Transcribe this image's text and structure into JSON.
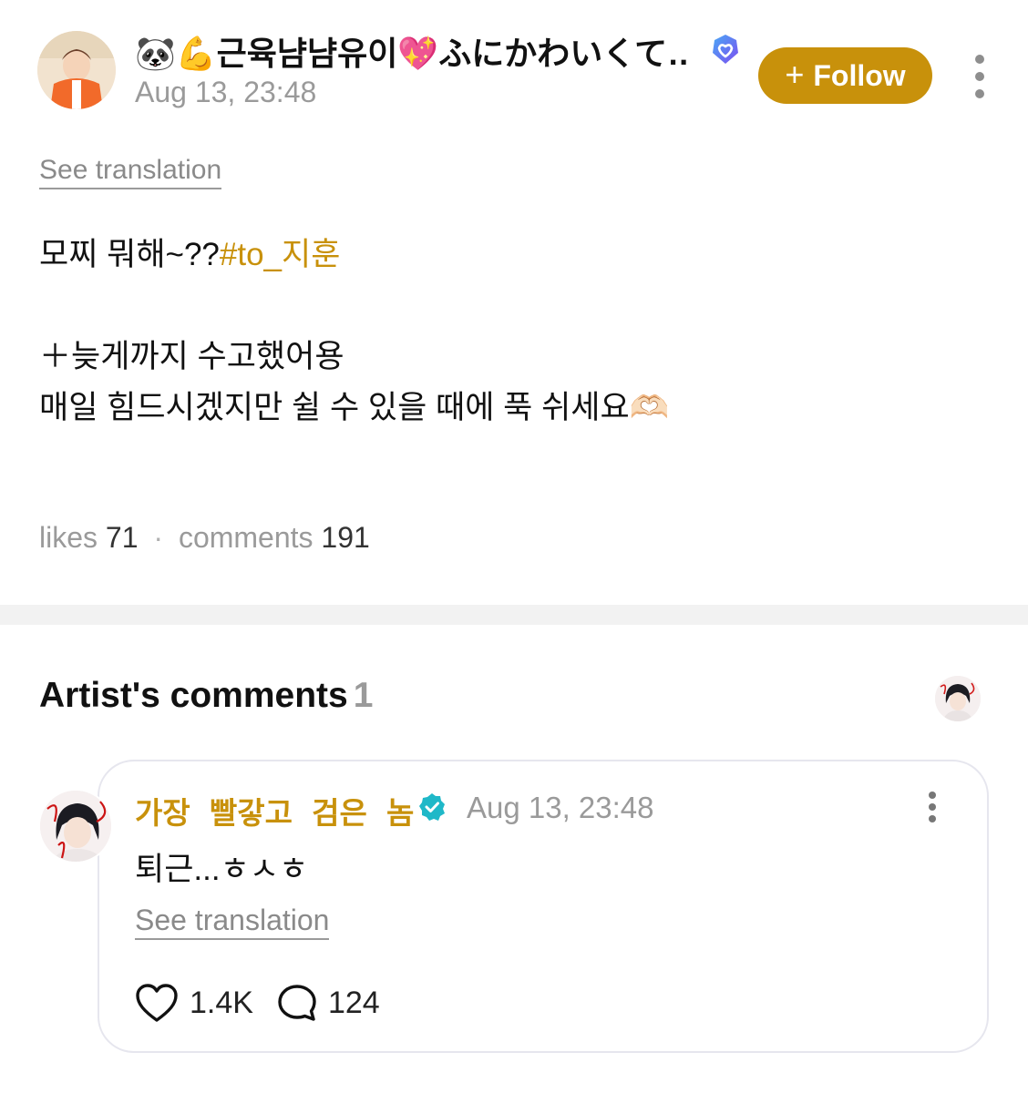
{
  "post": {
    "author": {
      "emoji": "🐼💪",
      "name": "근육냠냠유이",
      "emoji2": "💖",
      "name_suffix": "ふにかわいくて…",
      "verified": true
    },
    "timestamp": "Aug 13, 23:48",
    "follow_label": "Follow",
    "see_translation": "See translation",
    "body": {
      "line1_text": "모찌 뭐해~??",
      "line1_hashtag": "#to_지훈",
      "line2": "＋늦게까지 수고했어용",
      "line3": "매일 힘드시겠지만 쉴 수 있을 때에 푹 쉬세요🫶🏻"
    },
    "stats": {
      "likes_label": "likes",
      "likes_count": "71",
      "separator": "·",
      "comments_label": "comments",
      "comments_count": "191"
    }
  },
  "artist_comments": {
    "title": "Artist's comments",
    "count": "1",
    "items": [
      {
        "author": "가장 빨갛고 검은 놈",
        "verified": true,
        "timestamp": "Aug 13, 23:48",
        "text": "퇴근...ㅎㅅㅎ",
        "see_translation": "See translation",
        "likes": "1.4K",
        "replies": "124"
      }
    ]
  },
  "colors": {
    "accent": "#c8910b",
    "verified_blue": "#5b6cf0",
    "verified_teal": "#1fb8c8",
    "muted": "#9a9a9a"
  }
}
